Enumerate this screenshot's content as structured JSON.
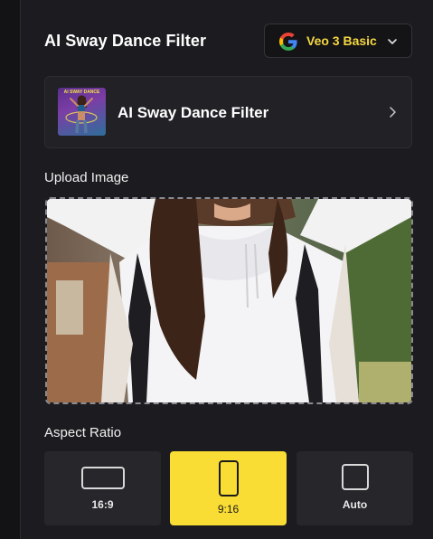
{
  "panel": {
    "title": "AI Sway Dance Filter"
  },
  "model_selector": {
    "label": "Veo 3 Basic",
    "icon": "google-g-icon",
    "accent": "#f5d742"
  },
  "filter_card": {
    "name": "AI Sway Dance Filter",
    "thumbnail_caption": "AI SWAY DANCE"
  },
  "upload": {
    "label": "Upload Image"
  },
  "aspect_ratio": {
    "label": "Aspect Ratio",
    "options": [
      {
        "label": "16:9",
        "selected": false
      },
      {
        "label": "9:16",
        "selected": true
      },
      {
        "label": "Auto",
        "selected": false
      }
    ],
    "selected_color": "#f9dd34"
  }
}
